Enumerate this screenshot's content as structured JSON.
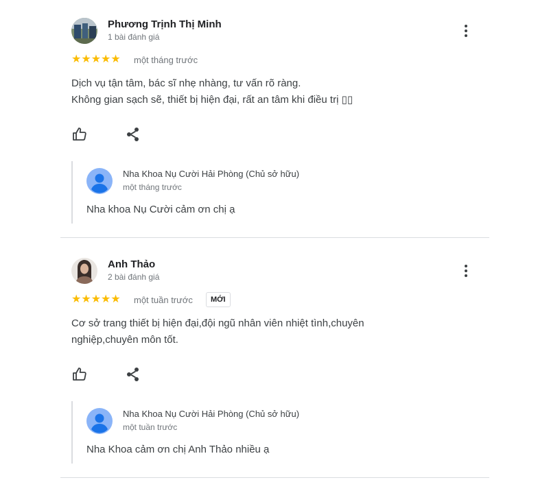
{
  "reviews": [
    {
      "author": "Phương Trịnh Thị Minh",
      "author_meta": "1 bài đánh giá",
      "rating": 5,
      "stars": "★★★★★",
      "time": "một tháng trước",
      "text_lines": [
        "Dịch vụ tận tâm, bác sĩ nhẹ nhàng, tư vấn rõ ràng.",
        "Không gian sạch sẽ, thiết bị hiện đại, rất an tâm khi điều trị ▯▯"
      ],
      "owner_reply": {
        "owner": "Nha Khoa Nụ Cười Hải Phòng (Chủ sở hữu)",
        "time": "một tháng trước",
        "text": "Nha khoa Nụ Cười cảm ơn chị ạ"
      }
    },
    {
      "author": "Anh Thảo",
      "author_meta": "2 bài đánh giá",
      "rating": 5,
      "stars": "★★★★★",
      "time": "một tuần trước",
      "badge": "MỚI",
      "text_lines": [
        "Cơ sở trang thiết bị hiện đại,đội ngũ nhân viên nhiệt tình,chuyên",
        "nghiệp,chuyên môn tốt."
      ],
      "owner_reply": {
        "owner": "Nha Khoa Nụ Cười Hải Phòng (Chủ sở hữu)",
        "time": "một tuần trước",
        "text": "Nha Khoa cảm ơn chị Anh Thảo nhiều ạ"
      }
    }
  ],
  "icons": {
    "like": "thumb-up-icon",
    "share": "share-icon",
    "more": "more-vert-icon"
  },
  "colors": {
    "star": "#fbbc04",
    "owner_avatar": "#8ab4f8",
    "divider": "#dadce0"
  }
}
